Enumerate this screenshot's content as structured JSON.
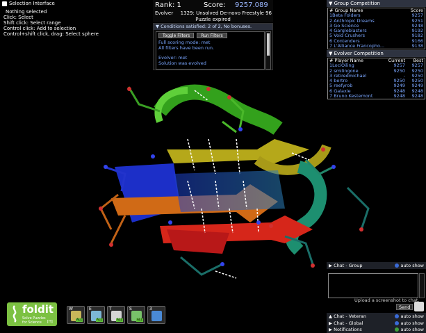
{
  "selection": {
    "title": "Selection Interface",
    "lines": [
      "Nothing selected",
      "Click: Select",
      "Shift click: Select range",
      "Control click: Add to selection",
      "Control+shift click, drag: Select sphere"
    ]
  },
  "score": {
    "rank_label": "Rank: 1",
    "score_label": "Score:",
    "score_value": "9257.089",
    "mode": "Evolver",
    "puzzle": "1329: Unsolved De-novo Freestyle 96",
    "status": "Puzzle expired"
  },
  "conditions": {
    "header": "Conditions satisfied: 2 of 2, No bonuses.",
    "toggle_label": "Toggle Filters",
    "run_label": "Run Filters",
    "lines": [
      "Full scoring mode: met",
      "All filters have been run.",
      "",
      "Evolver: met",
      "Solution was evolved"
    ]
  },
  "group_competition": {
    "title": "Group Competition",
    "col_name": "# Group Name",
    "col_score": "Score",
    "rows": [
      {
        "name": "1Beta Folders",
        "score": "9257"
      },
      {
        "name": "2 Anthropic Dreams",
        "score": "9251"
      },
      {
        "name": "3 Go Science",
        "score": "9248"
      },
      {
        "name": "4 Gargleblasters",
        "score": "9192"
      },
      {
        "name": "5 Void Crushers",
        "score": "9182"
      },
      {
        "name": "6 Contenders",
        "score": "9166"
      },
      {
        "name": "7 L'Alliance Francopho...",
        "score": "9138"
      }
    ]
  },
  "evolver_competition": {
    "title": "Evolver Competition",
    "col_name": "# Player Name",
    "col_current": "Current",
    "col_best": "Best",
    "rows": [
      {
        "name": "1LociOiling",
        "current": "9257",
        "best": "9257"
      },
      {
        "name": "2 smilingone",
        "current": "9250",
        "best": "9250"
      },
      {
        "name": "3 retiredmichael",
        "current": "-",
        "best": "9250"
      },
      {
        "name": "4 bertro",
        "current": "9250",
        "best": "9250"
      },
      {
        "name": "5 reefyrob",
        "current": "9249",
        "best": "9249"
      },
      {
        "name": "6 Galaxie",
        "current": "9248",
        "best": "9248"
      },
      {
        "name": "7 Bruno Kestemont",
        "current": "9248",
        "best": "9248"
      }
    ]
  },
  "chat": {
    "group_label": "Chat - Group",
    "auto_show": "auto show",
    "upload_note": "Upload a screenshot to chat.",
    "send_label": "Send",
    "veteran_label": "Chat - Veteran",
    "global_label": "Chat - Global",
    "notifications_label": "Notifications"
  },
  "logo": {
    "brand": "foldit",
    "tagline_1": "Solve Puzzles",
    "tagline_2": "for Science",
    "hotkey": "[H]"
  },
  "tools": [
    {
      "key": "W",
      "icon": "wiggle-icon",
      "color": "#c8b65a"
    },
    {
      "key": "E",
      "icon": "shake-icon",
      "color": "#7db7d6"
    },
    {
      "key": "T",
      "icon": "tweak-icon",
      "color": "#d5d5d5"
    },
    {
      "key": "S",
      "icon": "sidechain-icon",
      "color": "#78c26a"
    },
    {
      "key": "3",
      "icon": "move-arrows-icon",
      "color": "#4a8ad6"
    }
  ],
  "tool_all_label": "ALL"
}
